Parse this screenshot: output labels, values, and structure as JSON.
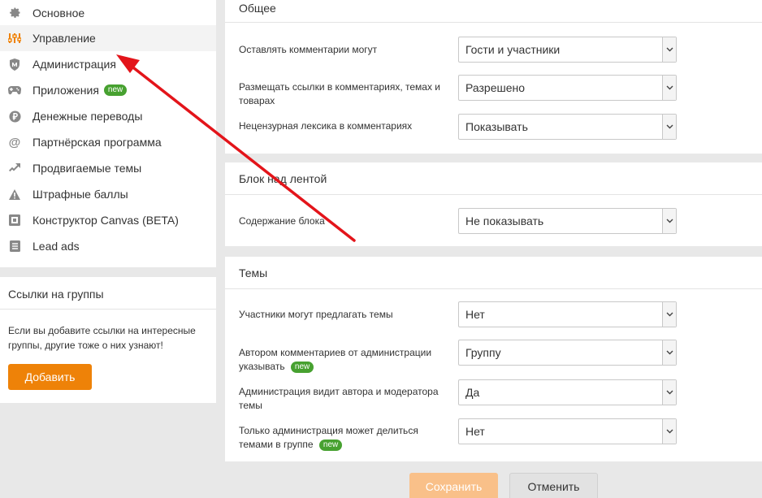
{
  "sidebar": {
    "items": [
      {
        "label": "Основное",
        "icon": "gear-icon"
      },
      {
        "label": "Управление",
        "icon": "sliders-icon"
      },
      {
        "label": "Администрация",
        "icon": "shield-icon"
      },
      {
        "label": "Приложения",
        "icon": "gamepad-icon",
        "badge": "new"
      },
      {
        "label": "Денежные переводы",
        "icon": "ruble-icon"
      },
      {
        "label": "Партнёрская программа",
        "icon": "at-icon"
      },
      {
        "label": "Продвигаемые темы",
        "icon": "trend-arrow-icon"
      },
      {
        "label": "Штрафные баллы",
        "icon": "warning-icon"
      },
      {
        "label": "Конструктор Canvas (BETA)",
        "icon": "canvas-icon"
      },
      {
        "label": "Lead ads",
        "icon": "list-icon"
      }
    ]
  },
  "links_card": {
    "title": "Ссылки на группы",
    "text": "Если вы добавите ссылки на интересные группы, другие тоже о них узнают!",
    "button": "Добавить"
  },
  "general": {
    "title": "Общее",
    "rows": [
      {
        "label": "Оставлять комментарии могут",
        "value": "Гости и участники"
      },
      {
        "label": "Размещать ссылки в комментариях, темах и товарах",
        "value": "Разрешено"
      },
      {
        "label": "Нецензурная лексика в комментариях",
        "value": "Показывать"
      }
    ]
  },
  "feed_block": {
    "title": "Блок над лентой",
    "rows": [
      {
        "label": "Содержание блока",
        "value": "Не показывать"
      }
    ]
  },
  "themes": {
    "title": "Темы",
    "rows": [
      {
        "label": "Участники могут предлагать темы",
        "value": "Нет"
      },
      {
        "label": "Автором комментариев от администрации указывать",
        "badge": "new",
        "value": "Группу"
      },
      {
        "label": "Администрация видит автора и модератора темы",
        "value": "Да"
      },
      {
        "label": "Только администрация может делиться темами в группе",
        "badge": "new",
        "value": "Нет"
      }
    ]
  },
  "actions": {
    "save": "Сохранить",
    "cancel": "Отменить"
  },
  "colors": {
    "accent": "#ee8208",
    "badge_green": "#47a130",
    "annotation_arrow": "#e3141a"
  }
}
